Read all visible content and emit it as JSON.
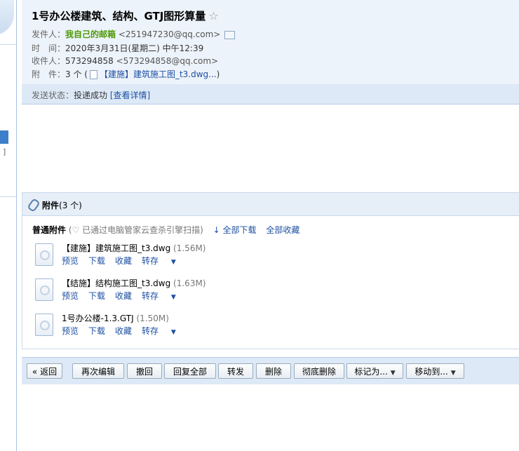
{
  "subject": "1号办公楼建筑、结构、GTJ图形算量",
  "sender": {
    "label": "发件人：",
    "name": "我自己的邮箱",
    "address": "<251947230@qq.com>"
  },
  "time": {
    "label": "时　间：",
    "value": "2020年3月31日(星期二) 中午12:39"
  },
  "recipient": {
    "label": "收件人：",
    "name": "573294858",
    "address": "<573294858@qq.com>"
  },
  "attachments_summary": {
    "label": "附　件：",
    "count": "3 个 (",
    "first": "【建施】建筑施工图_t3.dwg...",
    "close": ")"
  },
  "status": {
    "label": "发送状态：",
    "value": "投递成功",
    "detail_link": "[查看详情]"
  },
  "attachments": {
    "title": "附件",
    "count": "(3 个)",
    "section": "普通附件",
    "scan_note": "(♡ 已通过电脑管家云查杀引擎扫描)",
    "download_all": "全部下载",
    "save_all": "全部收藏",
    "files": [
      {
        "name": "【建施】建筑施工图_t3.dwg",
        "size": "(1.56M)"
      },
      {
        "name": "【结施】结构施工图_t3.dwg",
        "size": "(1.63M)"
      },
      {
        "name": "1号办公楼-1.3.GTJ",
        "size": "(1.50M)"
      }
    ],
    "file_actions": {
      "preview": "预览",
      "download": "下载",
      "favorite": "收藏",
      "forward": "转存"
    }
  },
  "toolbar": {
    "back": "« 返回",
    "edit_again": "再次编辑",
    "recall": "撤回",
    "reply_all": "回复全部",
    "forward": "转发",
    "delete": "删除",
    "delete_permanent": "彻底删除",
    "mark_as": "标记为...",
    "move_to": "移动到..."
  },
  "icons": [
    "star-icon",
    "vcard-icon",
    "attachment-file-icon",
    "paperclip-icon",
    "download-arrow-icon",
    "dropdown-caret-icon"
  ],
  "colors": {
    "header_bg": "#edf3fa",
    "status_bg": "#dde9f6",
    "link": "#1e50a2",
    "sender_green": "#4e9a06"
  }
}
